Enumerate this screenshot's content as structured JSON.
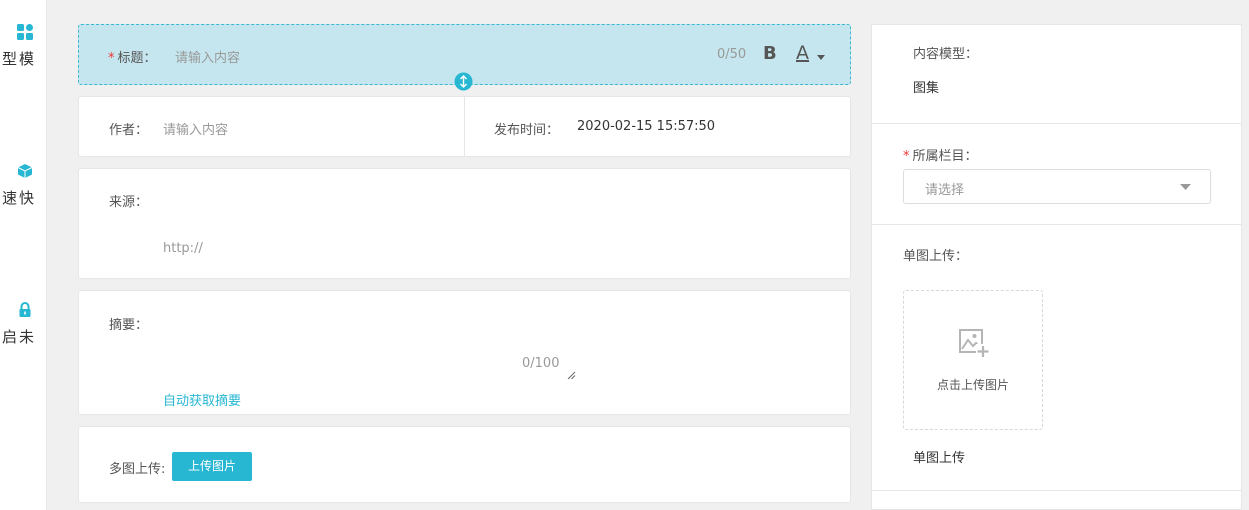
{
  "sidebar": {
    "items": [
      {
        "label": "模型组件",
        "icon": "grid-icon"
      },
      {
        "label": "快速组件",
        "icon": "cube-icon"
      },
      {
        "label": "未启用模型",
        "icon": "lock-icon"
      }
    ]
  },
  "title_field": {
    "required_mark": "*",
    "label": "标题：",
    "placeholder": "请输入内容",
    "count": "0/50",
    "bold_label": "B",
    "font_color_label": "A"
  },
  "author_field": {
    "label": "作者：",
    "placeholder": "请输入内容"
  },
  "publish_field": {
    "label": "发布时间：",
    "value": "2020-02-15 15:57:50"
  },
  "source_field": {
    "label": "来源：",
    "placeholder": "http://"
  },
  "summary_field": {
    "label": "摘要：",
    "count": "0/100",
    "auto_link": "自动获取摘要"
  },
  "multi_upload": {
    "label": "多图上传:",
    "button": "上传图片"
  },
  "right_panel": {
    "content_model_label": "内容模型：",
    "content_model_value": "图集",
    "category_required": "*",
    "category_label": "所属栏目：",
    "category_placeholder": "请选择",
    "single_upload_label": "单图上传：",
    "upload_hint": "点击上传图片",
    "single_upload_footer": "单图上传"
  },
  "colors": {
    "accent": "#28b7d3",
    "title_bg": "#c5e6ee",
    "required": "#ee3333"
  }
}
